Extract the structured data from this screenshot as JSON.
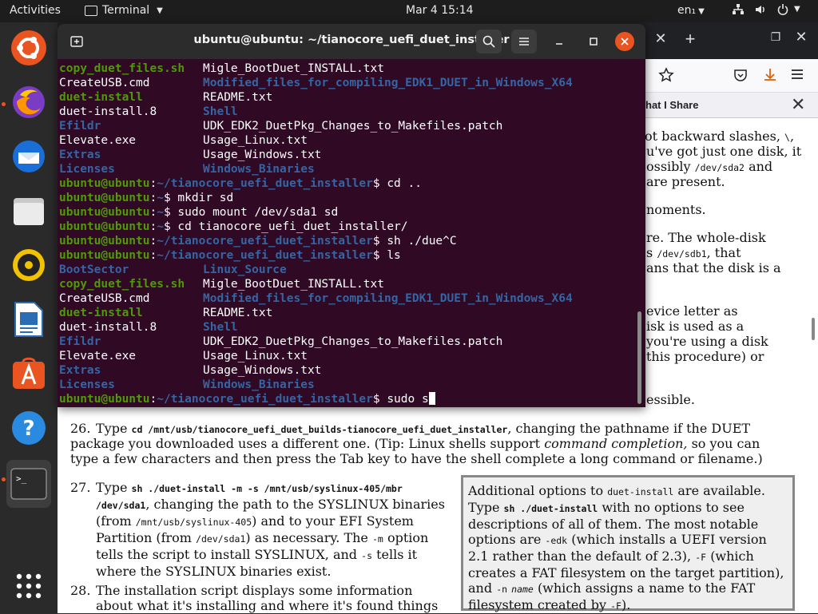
{
  "topbar": {
    "activities": "Activities",
    "app_name": "Terminal",
    "clock": "Mar 4  15:14",
    "language": "en₁"
  },
  "dock": {
    "apps": [
      "Ubuntu Software Center",
      "Firefox",
      "Thunderbird",
      "Files",
      "Rhythmbox",
      "LibreOffice Writer",
      "Ubuntu Software",
      "Help",
      "Terminal",
      "Show Applications"
    ]
  },
  "browser": {
    "tab_label": "hat I Share"
  },
  "doc": {
    "frag1": "ot backward slashes,",
    "frag1_code": "\\",
    "frag1_end": ",",
    "frag2": "u've got just one disk, it",
    "frag3_code": "/dev/sda2",
    "frag3_a": "ossibly",
    "frag3_b": "and",
    "frag4": "are present.",
    "frag5": "noments.",
    "frag6": "re. The whole-disk",
    "frag7_code": "/dev/sdb1",
    "frag7_a": "s",
    "frag7_b": ", that",
    "frag8": "ans that the disk is a",
    "frag9": "evice letter as",
    "frag10": "isk is used as a",
    "frag11": "you're using a disk",
    "frag12": "this procedure) or",
    "frag13": "essible.",
    "item26_num": "26.",
    "item26_a": "Type",
    "item26_code": "cd /mnt/usb/tianocore_uefi_duet_builds-tianocore_uefi_duet_installer",
    "item26_b": ", changing the pathname if the DUET",
    "item26_line2a": "package you downloaded uses a different one. (Tip: Linux shells support",
    "item26_line2em": "command completion,",
    "item26_line2b": "so you can",
    "item26_line3": "type a few characters and then press the Tab key to have the shell complete a long command or filename.)",
    "item27_num": "27.",
    "item27_a": "Type",
    "item27_code1": "sh ./duet-install -m -s /mnt/usb/syslinux-405/mbr",
    "item27_code2": "/dev/sda1",
    "item27_b": ", changing the path to the SYSLINUX binaries",
    "item27_c": "(from",
    "item27_code3": "/mnt/usb/syslinux-405",
    "item27_d": ") and to your EFI System",
    "item27_e": "Partition (from",
    "item27_code4": "/dev/sda1",
    "item27_f": ") as necessary. The",
    "item27_code5": "-m",
    "item27_g": "option",
    "item27_h": "tells the script to install SYSLINUX, and",
    "item27_code6": "-s",
    "item27_i": "tells it",
    "item27_j": "where the SYSLINUX binaries exist.",
    "item28_num": "28.",
    "item28_a": "The installation script displays some information",
    "item28_b": "about what it's installing and where it's found things",
    "box_l1a": "Additional options to",
    "box_l1code": "duet-install",
    "box_l1b": "are available.",
    "box_l2a": "Type",
    "box_l2code": "sh ./duet-install",
    "box_l2b": "with no options to see",
    "box_l3": "descriptions of all of them. The most notable",
    "box_l4a": "options are",
    "box_l4code": "-edk",
    "box_l4b": "(which installs a UEFI version",
    "box_l5a": "2.1 rather than the default of 2.3),",
    "box_l5code": "-F",
    "box_l5b": "(which",
    "box_l6": "creates a FAT filesystem on the target partition),",
    "box_l7a": "and",
    "box_l7code": "-n",
    "box_l7em": "name",
    "box_l7b": "(which assigns a name to the FAT",
    "box_l8a": "filesystem created by",
    "box_l8code": "-F",
    "box_l8b": ")."
  },
  "terminal": {
    "title": "ubuntu@ubuntu: ~/tianocore_uefi_duet_installer",
    "prompt_user": "ubuntu@ubuntu",
    "lines": [
      {
        "c1": "copy_duet_files.sh",
        "c1c": "green",
        "c2": "Migle_BootDuet_INSTALL.txt",
        "c2c": "white"
      },
      {
        "c1": "CreateUSB.cmd",
        "c1c": "white",
        "c2": "Modified_files_for_compiling_EDK1_DUET_in_Windows_X64",
        "c2c": "blue"
      },
      {
        "c1": "duet-install",
        "c1c": "green",
        "c2": "README.txt",
        "c2c": "white"
      },
      {
        "c1": "duet-install.8",
        "c1c": "white",
        "c2": "Shell",
        "c2c": "blue"
      },
      {
        "c1": "Efildr",
        "c1c": "blue",
        "c2": "UDK_EDK2_DuetPkg_Changes_to_Makefiles.patch",
        "c2c": "white"
      },
      {
        "c1": "Elevate.exe",
        "c1c": "white",
        "c2": "Usage_Linux.txt",
        "c2c": "white"
      },
      {
        "c1": "Extras",
        "c1c": "blue",
        "c2": "Usage_Windows.txt",
        "c2c": "white"
      },
      {
        "c1": "Licenses",
        "c1c": "blue",
        "c2": "Windows_Binaries",
        "c2c": "blue"
      }
    ],
    "commands": [
      {
        "path": "~/tianocore_uefi_duet_installer",
        "cmd": "$ cd .."
      },
      {
        "path": "~",
        "cmd": "$ mkdir sd"
      },
      {
        "path": "~",
        "cmd": "$ sudo mount /dev/sda1 sd"
      },
      {
        "path": "~",
        "cmd": "$ cd tianocore_uefi_duet_installer/"
      },
      {
        "path": "~/tianocore_uefi_duet_installer",
        "cmd": "$ sh ./due^C"
      },
      {
        "path": "~/tianocore_uefi_duet_installer",
        "cmd": "$ ls"
      }
    ],
    "lines2": [
      {
        "c1": "BootSector",
        "c1c": "blue",
        "c2": "Linux_Source",
        "c2c": "blue"
      },
      {
        "c1": "copy_duet_files.sh",
        "c1c": "green",
        "c2": "Migle_BootDuet_INSTALL.txt",
        "c2c": "white"
      },
      {
        "c1": "CreateUSB.cmd",
        "c1c": "white",
        "c2": "Modified_files_for_compiling_EDK1_DUET_in_Windows_X64",
        "c2c": "blue"
      },
      {
        "c1": "duet-install",
        "c1c": "green",
        "c2": "README.txt",
        "c2c": "white"
      },
      {
        "c1": "duet-install.8",
        "c1c": "white",
        "c2": "Shell",
        "c2c": "blue"
      },
      {
        "c1": "Efildr",
        "c1c": "blue",
        "c2": "UDK_EDK2_DuetPkg_Changes_to_Makefiles.patch",
        "c2c": "white"
      },
      {
        "c1": "Elevate.exe",
        "c1c": "white",
        "c2": "Usage_Linux.txt",
        "c2c": "white"
      },
      {
        "c1": "Extras",
        "c1c": "blue",
        "c2": "Usage_Windows.txt",
        "c2c": "white"
      },
      {
        "c1": "Licenses",
        "c1c": "blue",
        "c2": "Windows_Binaries",
        "c2c": "blue"
      }
    ],
    "last_prompt_path": "~/tianocore_uefi_duet_installer",
    "last_cmd": "$ sudo s"
  },
  "colors": {
    "terminal_bg": "#300a24",
    "green": "#4e9a06",
    "blue": "#3465a4",
    "ubuntu_orange": "#e95420"
  }
}
